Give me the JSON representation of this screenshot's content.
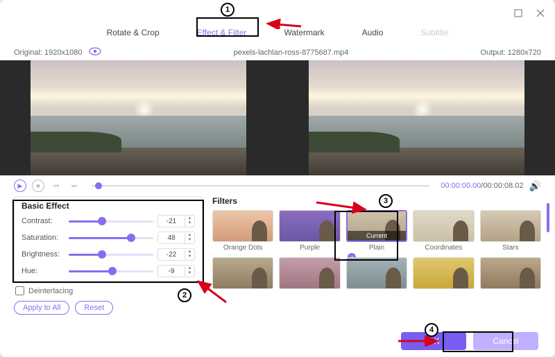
{
  "tabs": {
    "rotate": "Rotate & Crop",
    "effect": "Effect & Filter",
    "watermark": "Watermark",
    "audio": "Audio",
    "subtitle": "Subtitle"
  },
  "info": {
    "original_label": "Original: 1920x1080",
    "filename": "pexels-lachlan-ross-8775687.mp4",
    "output_label": "Output: 1280x720"
  },
  "time": {
    "current": "00:00:00.00",
    "sep": "/",
    "total": "00:00:08.02"
  },
  "basic_effect": {
    "title": "Basic Effect",
    "rows": [
      {
        "label": "Contrast:",
        "value": "-21",
        "percent": 39
      },
      {
        "label": "Saturation:",
        "value": "48",
        "percent": 74
      },
      {
        "label": "Brightness:",
        "value": "-22",
        "percent": 39
      },
      {
        "label": "Hue:",
        "value": "-9",
        "percent": 52
      }
    ],
    "deinterlacing": "Deinterlacing",
    "apply_all": "Apply to All",
    "reset": "Reset"
  },
  "filters": {
    "title": "Filters",
    "items": [
      {
        "name": "Orange Dots"
      },
      {
        "name": "Purple"
      },
      {
        "name": "Plain",
        "current": "Current"
      },
      {
        "name": "Coordinates"
      },
      {
        "name": "Stars"
      }
    ]
  },
  "footer": {
    "ok": "OK",
    "cancel": "Cancel"
  },
  "callouts": {
    "c1": "1",
    "c2": "2",
    "c3": "3",
    "c4": "4"
  }
}
